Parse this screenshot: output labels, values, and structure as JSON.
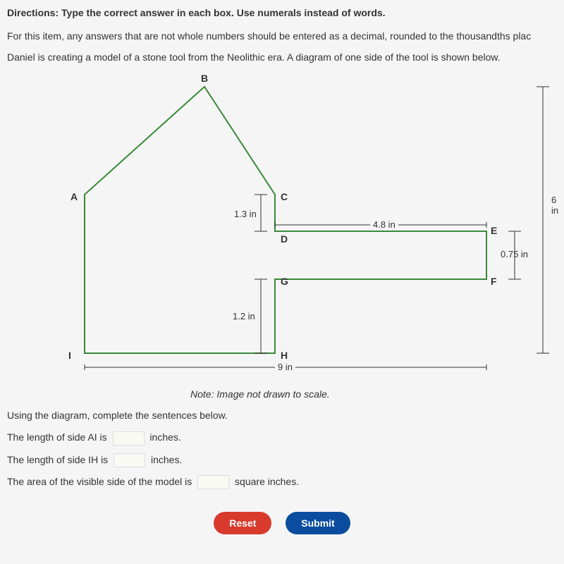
{
  "directions": "Directions: Type the correct answer in each box. Use numerals instead of words.",
  "problem": {
    "line1": "For this item, any answers that are not whole numbers should be entered as a decimal, rounded to the thousandths plac",
    "line2": "Daniel is creating a model of a stone tool from the Neolithic era. A diagram of one side of the tool is shown below."
  },
  "diagram": {
    "vertices": {
      "A": "A",
      "B": "B",
      "C": "C",
      "D": "D",
      "E": "E",
      "F": "F",
      "G": "G",
      "H": "H",
      "I": "I"
    },
    "measures": {
      "cd": "1.3 in",
      "de": "4.8 in",
      "ef": "0.75 in",
      "gh": "1.2 in",
      "hi": "9 in",
      "total_height": "6 in"
    }
  },
  "note": "Note: Image not drawn to scale.",
  "questions": {
    "intro": "Using the diagram, complete the sentences below.",
    "q1_pre": "The length of side AI is",
    "q1_post": "inches.",
    "q2_pre": "The length of side IH is",
    "q2_post": "inches.",
    "q3_pre": "The area of the visible side of the model is",
    "q3_post": "square inches."
  },
  "buttons": {
    "reset": "Reset",
    "submit": "Submit"
  }
}
